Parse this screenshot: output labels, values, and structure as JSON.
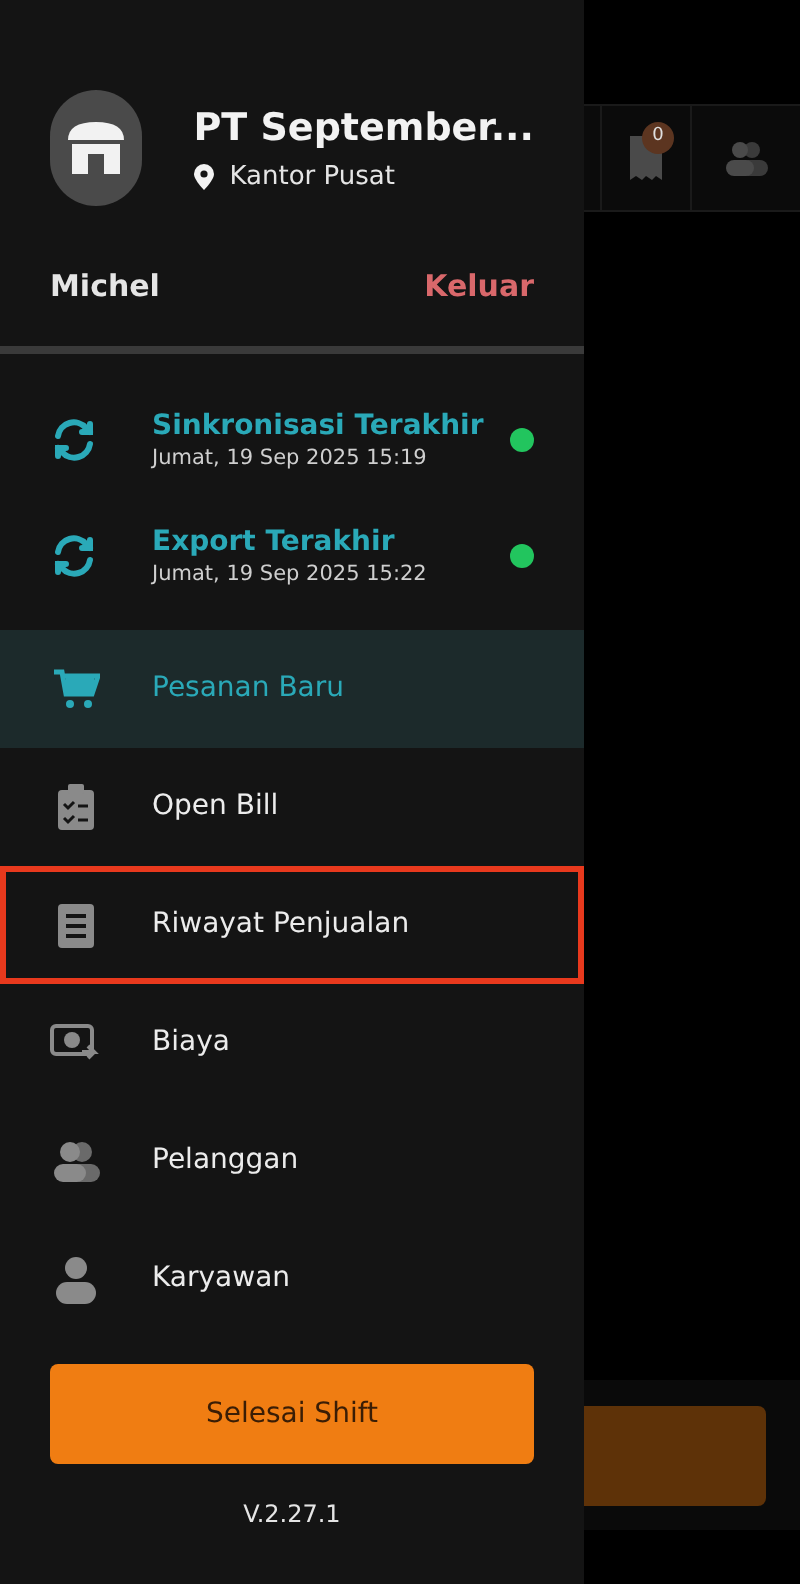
{
  "drawer": {
    "company": "PT September...",
    "location": "Kantor Pusat",
    "user": "Michel",
    "logout": "Keluar",
    "sync": [
      {
        "title": "Sinkronisasi Terakhir",
        "time": "Jumat, 19 Sep 2025 15:19",
        "color": "#22c55e"
      },
      {
        "title": "Export Terakhir",
        "time": "Jumat, 19 Sep 2025 15:22",
        "color": "#22c55e"
      }
    ],
    "menu": [
      {
        "label": "Pesanan Baru",
        "kind": "cart",
        "selected": true,
        "outlined": false
      },
      {
        "label": "Open Bill",
        "kind": "clipboard",
        "selected": false,
        "outlined": false
      },
      {
        "label": "Riwayat Penjualan",
        "kind": "document",
        "selected": false,
        "outlined": true
      },
      {
        "label": "Biaya",
        "kind": "money",
        "selected": false,
        "outlined": false
      },
      {
        "label": "Pelanggan",
        "kind": "users",
        "selected": false,
        "outlined": false
      },
      {
        "label": "Karyawan",
        "kind": "user",
        "selected": false,
        "outlined": false
      }
    ],
    "end_shift": "Selesai Shift",
    "version": "V.2.27.1"
  },
  "background": {
    "receipt_badge": "0"
  }
}
